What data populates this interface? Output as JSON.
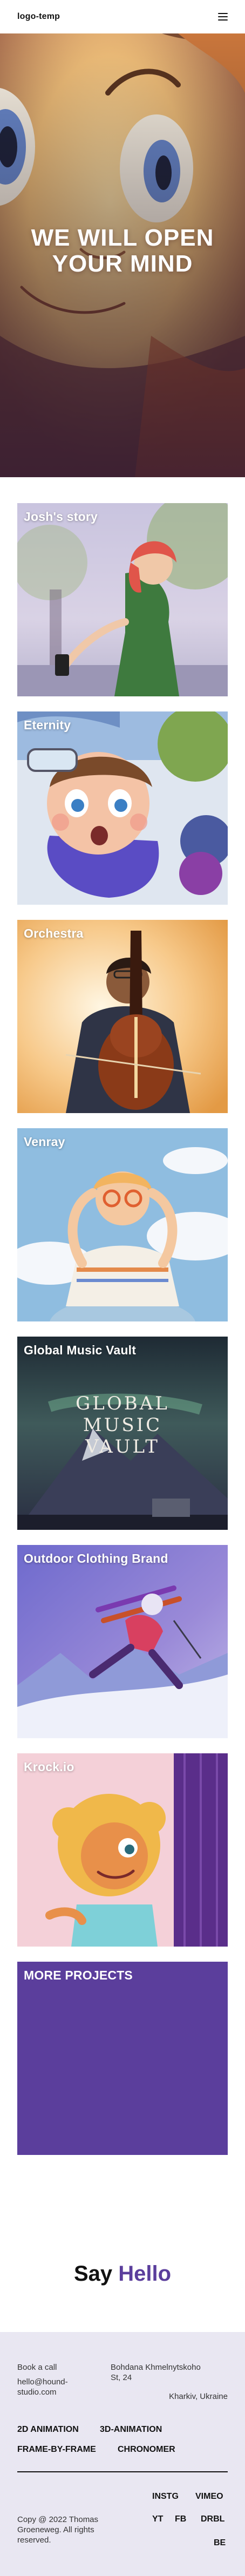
{
  "header": {
    "logo": "logo-temp",
    "menu_icon": "hamburger-icon"
  },
  "hero": {
    "title_line1": "WE WILL OPEN",
    "title_line2": "YOUR MIND"
  },
  "projects": [
    {
      "title": "Josh's story"
    },
    {
      "title": "Eternity"
    },
    {
      "title": "Orchestra"
    },
    {
      "title": "Venray"
    },
    {
      "title": "Global Music Vault",
      "artwork_text": [
        "GLOBAL",
        "MUSIC",
        "VAULT"
      ]
    },
    {
      "title": "Outdoor Clothing Brand"
    },
    {
      "title": "Krock.io"
    },
    {
      "title": "MORE PROJECTS",
      "color": "#5b3e9c"
    }
  ],
  "say_hello": {
    "part1": "Say",
    "part2": "Hello",
    "accent": "#5b3e9c"
  },
  "footer": {
    "book_call": "Book a call",
    "email_line1": "hello@hound-",
    "email_line2": "studio.com",
    "address_line1": "Bohdana Khmelnytskoho",
    "address_line2": "St, 24",
    "city": "Kharkiv, Ukraine",
    "nav": [
      "2D ANIMATION",
      "3D-ANIMATION",
      "FRAME-BY-FRAME",
      "CHRONOMER"
    ],
    "copyright_line1": "Copy @ 2022 Thomas",
    "copyright_line2": "Groeneweg. All rights",
    "copyright_line3": "reserved.",
    "social": [
      "INSTG",
      "VIMEO",
      "YT",
      "FB",
      "DRBL",
      "BE"
    ]
  }
}
